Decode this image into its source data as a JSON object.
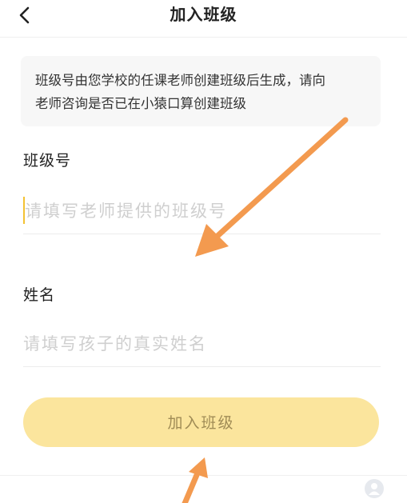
{
  "header": {
    "title": "加入班级",
    "back_icon": "chevron-left-icon"
  },
  "notice": {
    "line1": "班级号由您学校的任课老师创建班级后生成，请向",
    "line2": "老师咨询是否已在小猿口算创建班级"
  },
  "form": {
    "class_label": "班级号",
    "class_placeholder": "请填写老师提供的班级号",
    "class_value": "",
    "name_label": "姓名",
    "name_placeholder": "请填写孩子的真实姓名",
    "name_value": ""
  },
  "submit": {
    "label": "加入班级"
  },
  "colors": {
    "accent": "#f3c233",
    "button_bg": "#fbe59d",
    "button_text": "#a08c56",
    "annotation_arrow": "#f39a4f"
  },
  "floating_icon": "service-icon"
}
